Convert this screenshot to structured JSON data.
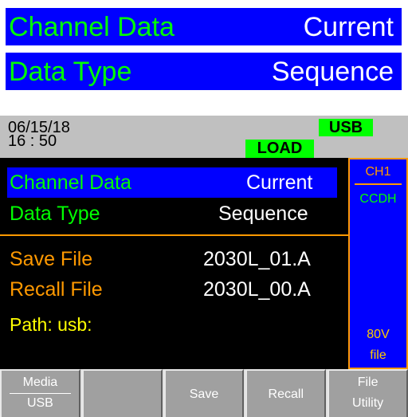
{
  "banner": {
    "channel_data": {
      "label": "Channel Data",
      "value": "Current"
    },
    "data_type": {
      "label": "Data Type",
      "value": "Sequence"
    }
  },
  "status": {
    "date": "06/15/18",
    "time": "16 : 50",
    "usb_badge": "USB",
    "load_badge": "LOAD"
  },
  "menu": {
    "channel_data": {
      "label": "Channel Data",
      "value": "Current"
    },
    "data_type": {
      "label": "Data Type",
      "value": "Sequence"
    },
    "save_file": {
      "label": "Save File",
      "value": "2030L_01.A"
    },
    "recall_file": {
      "label": "Recall File",
      "value": "2030L_00.A"
    },
    "path": "Path:  usb:"
  },
  "side": {
    "channel": "CH1",
    "mode": "CCDH",
    "voltage": "80V",
    "kind": "file"
  },
  "softkeys": {
    "media": {
      "top": "Media",
      "bottom": "USB"
    },
    "save": "Save",
    "recall": "Recall",
    "file_utility": {
      "top": "File",
      "bottom": "Utility"
    }
  },
  "colors": {
    "banner_bg": "#0000ff",
    "label_green": "#00ff00",
    "accent_orange": "#ff9900",
    "path_yellow": "#ffff00",
    "screen_black": "#000000",
    "status_gray": "#c0c0c0",
    "key_gray": "#a0a0a0"
  }
}
